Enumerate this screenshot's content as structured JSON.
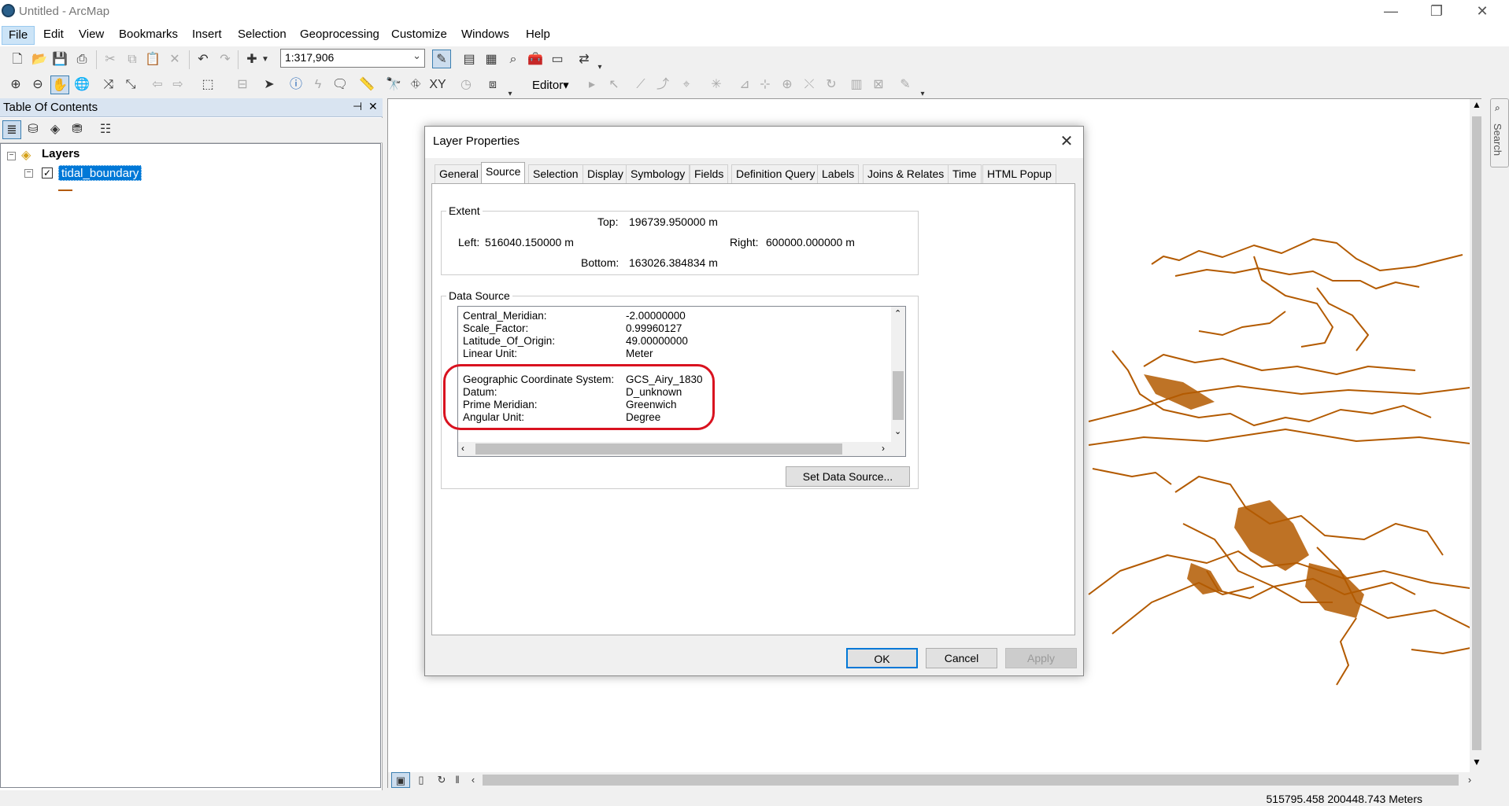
{
  "window": {
    "title": "Untitled - ArcMap",
    "minimize": "—",
    "restore": "❐",
    "close": "✕"
  },
  "menu": [
    "File",
    "Edit",
    "View",
    "Bookmarks",
    "Insert",
    "Selection",
    "Geoprocessing",
    "Customize",
    "Windows",
    "Help"
  ],
  "toolbar": {
    "scale": "1:317,906",
    "editor": "Editor▾"
  },
  "toc": {
    "title": "Table Of Contents",
    "pin": "⊣",
    "close": "✕",
    "root": "Layers",
    "layer": "tidal_boundary"
  },
  "dialog": {
    "title": "Layer Properties",
    "tabs": [
      "General",
      "Source",
      "Selection",
      "Display",
      "Symbology",
      "Fields",
      "Definition Query",
      "Labels",
      "Joins & Relates",
      "Time",
      "HTML Popup"
    ],
    "selected_tab": "Source",
    "extent": {
      "legend": "Extent",
      "top_label": "Top:",
      "top": "196739.950000 m",
      "left_label": "Left:",
      "left": "516040.150000 m",
      "right_label": "Right:",
      "right": "600000.000000 m",
      "bottom_label": "Bottom:",
      "bottom": "163026.384834 m"
    },
    "data_source": {
      "legend": "Data Source",
      "rows": [
        {
          "k": "Central_Meridian:",
          "v": "-2.00000000"
        },
        {
          "k": "Scale_Factor:",
          "v": "0.99960127"
        },
        {
          "k": "Latitude_Of_Origin:",
          "v": "49.00000000"
        },
        {
          "k": "Linear Unit:",
          "v": "Meter"
        },
        {
          "k": "Geographic Coordinate System:",
          "v": "GCS_Airy_1830"
        },
        {
          "k": "Datum:",
          "v": "D_unknown"
        },
        {
          "k": "Prime Meridian:",
          "v": "Greenwich"
        },
        {
          "k": "Angular Unit:",
          "v": "Degree"
        }
      ],
      "set_button": "Set Data Source..."
    },
    "ok": "OK",
    "cancel": "Cancel",
    "apply": "Apply"
  },
  "status": {
    "coords": "515795.458  200448.743 Meters"
  },
  "search_tab": "Search",
  "colors": {
    "feature": "#b35a00",
    "selection": "#0078d7",
    "highlight": "#d9121f"
  }
}
